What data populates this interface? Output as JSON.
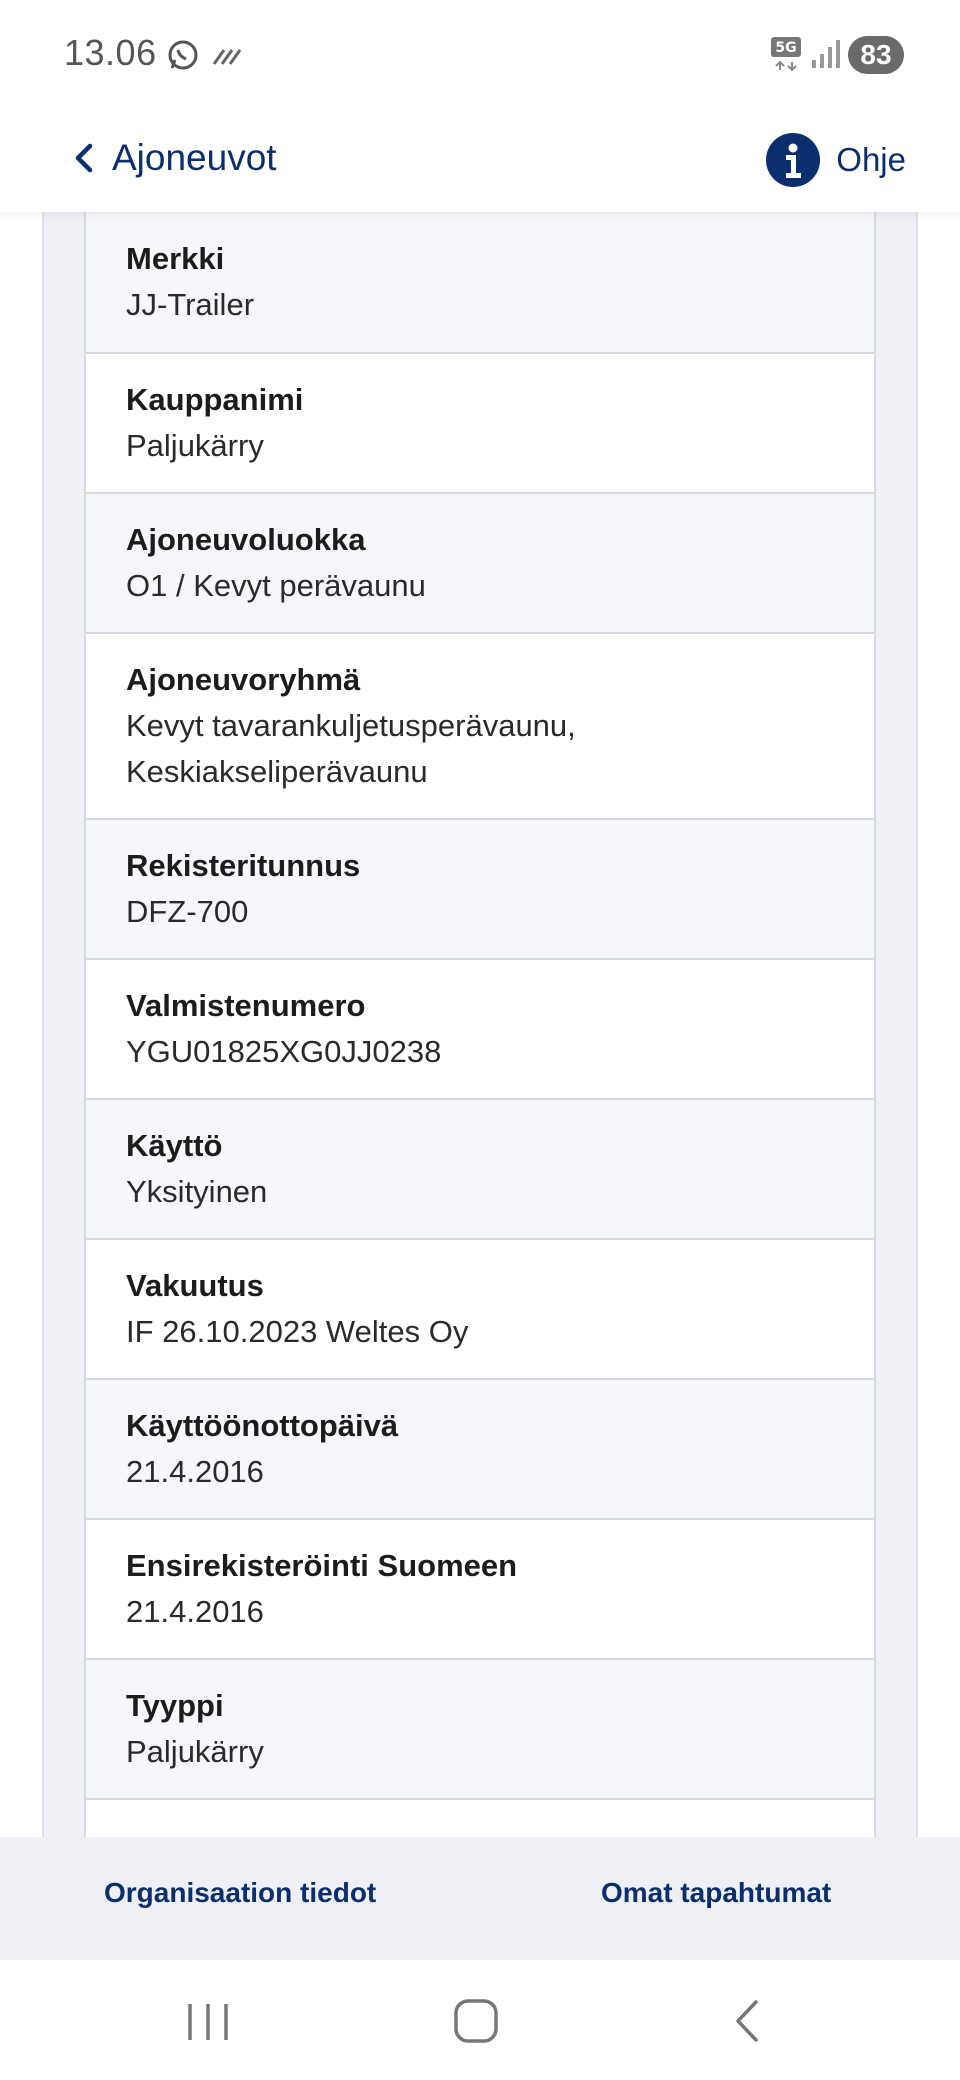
{
  "status_bar": {
    "time": "13.06",
    "network": "5G",
    "battery": "83"
  },
  "header": {
    "back_label": "Ajoneuvot",
    "help_label": "Ohje"
  },
  "details": [
    {
      "label": "Merkki",
      "value": "JJ-Trailer"
    },
    {
      "label": "Kauppanimi",
      "value": "Paljukärry"
    },
    {
      "label": "Ajoneuvoluokka",
      "value": "O1 / Kevyt perävaunu"
    },
    {
      "label": "Ajoneuvoryhmä",
      "value": "Kevyt tavarankuljetusperävaunu,",
      "value2": "Keskiakseliperävaunu"
    },
    {
      "label": "Rekisteritunnus",
      "value": "DFZ-700"
    },
    {
      "label": "Valmistenumero",
      "value": "YGU01825XG0JJ0238"
    },
    {
      "label": "Käyttö",
      "value": "Yksityinen"
    },
    {
      "label": "Vakuutus",
      "value": "IF 26.10.2023 Weltes Oy"
    },
    {
      "label": "Käyttöönottopäivä",
      "value": "21.4.2016"
    },
    {
      "label": "Ensirekisteröinti Suomeen",
      "value": "21.4.2016"
    },
    {
      "label": "Tyyppi",
      "value": "Paljukärry"
    }
  ],
  "bottom_nav": {
    "left": "Organisaation tiedot",
    "right": "Omat tapahtumat"
  },
  "icons": {
    "back": "chevron-left-icon",
    "help": "info-icon",
    "whatsapp": "whatsapp-icon",
    "signal": "signal-icon"
  },
  "colors": {
    "brand": "#0b2e6e",
    "panel": "#eff1f6",
    "row_shaded": "#f6f7fa"
  }
}
